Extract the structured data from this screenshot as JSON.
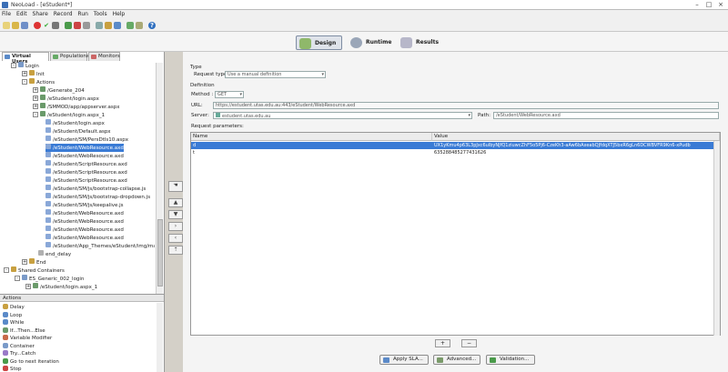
{
  "window": {
    "title": "NeoLoad - [eStudent*]"
  },
  "menu": [
    "File",
    "Edit",
    "Share",
    "Record",
    "Run",
    "Tools",
    "Help"
  ],
  "modes": [
    {
      "label": "Design",
      "icon": "design-icon",
      "active": true
    },
    {
      "label": "Runtime",
      "icon": "runtime-icon",
      "active": false
    },
    {
      "label": "Results",
      "icon": "results-icon",
      "active": false
    }
  ],
  "left_tabs": [
    {
      "label": "Virtual Users",
      "active": true
    },
    {
      "label": "Populations",
      "active": false
    },
    {
      "label": "Monitors",
      "active": false
    }
  ],
  "tree": [
    {
      "label": "Login",
      "exp": "-"
    },
    {
      "label": "Init",
      "exp": "+"
    },
    {
      "label": "Actions",
      "exp": "-"
    },
    {
      "label": "/Generate_204",
      "exp": "+"
    },
    {
      "label": "/eStudent/login.aspx",
      "exp": "+"
    },
    {
      "label": "/SMMOD/app/appserver.aspx",
      "exp": "+"
    },
    {
      "label": "/eStudent/login.aspx_1",
      "exp": "-"
    },
    {
      "label": "/eStudent/login.aspx",
      "exp": ""
    },
    {
      "label": "/eStudent/Default.aspx",
      "exp": ""
    },
    {
      "label": "/eStudent/SM/PersDtls10.aspx",
      "exp": ""
    },
    {
      "label": "/eStudent/WebResource.axd",
      "exp": ""
    },
    {
      "label": "/eStudent/WebResource.axd",
      "exp": ""
    },
    {
      "label": "/eStudent/ScriptResource.axd",
      "exp": ""
    },
    {
      "label": "/eStudent/ScriptResource.axd",
      "exp": ""
    },
    {
      "label": "/eStudent/ScriptResource.axd",
      "exp": ""
    },
    {
      "label": "/eStudent/SM/js/bootstrap-collapse.js",
      "exp": ""
    },
    {
      "label": "/eStudent/SM/js/bootstrap-dropdown.js",
      "exp": ""
    },
    {
      "label": "/eStudent/SM/js/keepalive.js",
      "exp": ""
    },
    {
      "label": "/eStudent/WebResource.axd",
      "exp": ""
    },
    {
      "label": "/eStudent/WebResource.axd",
      "exp": ""
    },
    {
      "label": "/eStudent/WebResource.axd",
      "exp": ""
    },
    {
      "label": "/eStudent/WebResource.axd",
      "exp": ""
    },
    {
      "label": "/eStudent/App_Themes/eStudent/img/master.ht",
      "exp": ""
    },
    {
      "label": "end_delay",
      "exp": ""
    },
    {
      "label": "End",
      "exp": "+"
    },
    {
      "label": "Shared Containers",
      "exp": "-"
    },
    {
      "label": "ES_Generic_002_login",
      "exp": "-"
    },
    {
      "label": "/eStudent/login.aspx_1",
      "exp": "+"
    }
  ],
  "actions_panel": {
    "title": "Actions",
    "items": [
      "Delay",
      "Loop",
      "While",
      "If...Then...Else",
      "Variable Modifier",
      "Container",
      "Try...Catch",
      "Go to next iteration",
      "Stop"
    ]
  },
  "request": {
    "type_section": "Type",
    "request_type_label": "Request type:",
    "request_type_value": "Use a manual definition",
    "definition_section": "Definition",
    "method_label": "Method :",
    "method_value": "GET",
    "url_label": "URL:",
    "url_value": "https://estudent.utas.edu.au:443/eStudent/WebResource.axd",
    "server_label": "Server:",
    "server_value": "estudent.utas.edu.au",
    "path_label": "Path:",
    "path_value": "/eStudent/WebResource.axd",
    "params_label": "Request parameters:"
  },
  "params_table": {
    "columns": [
      "Name",
      "Value"
    ],
    "rows": [
      {
        "name": "d",
        "value": "UX1yKmu4p63L3pJxc6ulbyNJfQ1ziuwcZhF5o5Pj6-CzeKh3-aAw6bAxeabQJfdqXTJ5bxR6gLn6DCWBVFR9Kn6-xPudb",
        "selected": true
      },
      {
        "name": "t",
        "value": "635288485277431626",
        "selected": false
      }
    ]
  },
  "param_buttons": {
    "add": "+",
    "remove": "−"
  },
  "bottom_buttons": [
    "Apply SLA...",
    "Advanced...",
    "Validation..."
  ]
}
